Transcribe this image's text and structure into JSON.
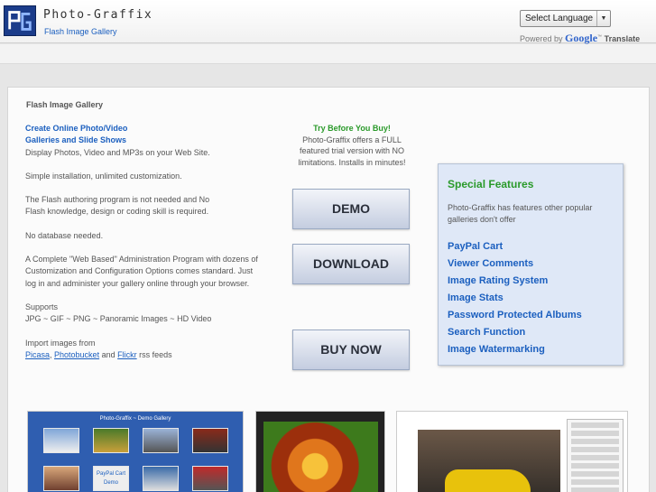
{
  "header": {
    "title": "Photo-Graffix",
    "subtitle": "Flash Image Gallery",
    "language_select": "Select Language",
    "powered_by": "Powered by",
    "google": "Google",
    "translate": "Translate"
  },
  "panel": {
    "title": "Flash Image Gallery",
    "intro_link": "Create Online Photo/Video Galleries and Slide Shows",
    "paragraphs": [
      "Display Photos, Video and MP3s on your Web Site.",
      "Simple installation, unlimited customization.",
      "The Flash authoring program is not needed and No Flash knowledge, design or coding skill is required.",
      "No database needed.",
      "A Complete \"Web Based\" Administration Program with dozens of Customization and Configuration Options comes standard. Just log in and administer your gallery online through your browser."
    ],
    "supports_label": "Supports",
    "supports_formats": "JPG ~ GIF ~ PNG ~ Panoramic Images ~ HD Video",
    "import_label": "Import images from",
    "import_links": [
      "Picasa",
      "Photobucket",
      "Flickr"
    ],
    "import_and": "and",
    "import_suffix": "rss feeds"
  },
  "trial": {
    "heading": "Try Before You Buy!",
    "text": "Photo-Graffix offers a FULL featured trial version with NO limitations. Installs in minutes!"
  },
  "buttons": {
    "demo": "DEMO",
    "download": "DOWNLOAD",
    "buy": "BUY NOW"
  },
  "features": {
    "heading": "Special Features",
    "description": "Photo-Graffix has features other popular galleries don't offer",
    "items": [
      "PayPal Cart",
      "Viewer Comments",
      "Image Rating System",
      "Image Stats",
      "Password Protected Albums",
      "Search Function",
      "Image Watermarking"
    ]
  },
  "thumbnails": {
    "gallery_demo_title": "Photo-Graffix ~ Demo Gallery",
    "paypal_tile": "PayPal Cart Demo"
  },
  "colors": {
    "link_blue": "#1b5fbf",
    "accent_green": "#2a9a2a",
    "features_bg": "#dfe8f7"
  }
}
